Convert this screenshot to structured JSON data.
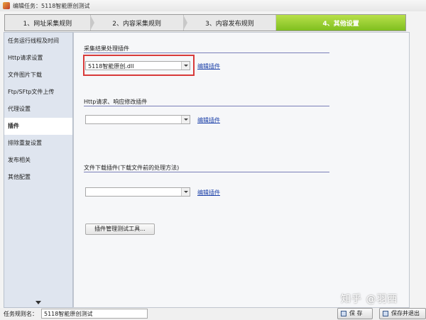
{
  "window": {
    "title": "编辑任务：5118智能原创测试"
  },
  "wizard": {
    "steps": [
      {
        "label": "1、网址采集规则"
      },
      {
        "label": "2、内容采集规则"
      },
      {
        "label": "3、内容发布规则"
      },
      {
        "label": "4、其他设置"
      }
    ],
    "active_index": 3,
    "active_color": "#8cc63f"
  },
  "sidebar": {
    "items": [
      {
        "label": "任务运行线程及时间"
      },
      {
        "label": "Http请求设置"
      },
      {
        "label": "文件图片下载"
      },
      {
        "label": "Ftp/SFtp文件上传"
      },
      {
        "label": "代理设置"
      },
      {
        "label": "插件"
      },
      {
        "label": "排除重复设置"
      },
      {
        "label": "发布相关"
      },
      {
        "label": "其他配置"
      }
    ],
    "active_index": 5
  },
  "main": {
    "section1": {
      "label": "采集结果处理插件",
      "value": "5118智能原创.dll",
      "edit_label": "编辑插件"
    },
    "section2": {
      "label": "Http请求、响应修改插件",
      "value": "",
      "edit_label": "编辑插件"
    },
    "section3": {
      "label": "文件下载插件(下载文件前的处理方法)",
      "value": "",
      "edit_label": "编辑插件"
    },
    "tool_button": "插件管理测试工具...",
    "highlight_color": "#d83a3a"
  },
  "bottom": {
    "task_name_label": "任务规则名：",
    "task_name_value": "5118智能原创测试",
    "save_label": "保 存",
    "save_exit_label": "保存并退出"
  },
  "watermark": "知乎 @羽西"
}
